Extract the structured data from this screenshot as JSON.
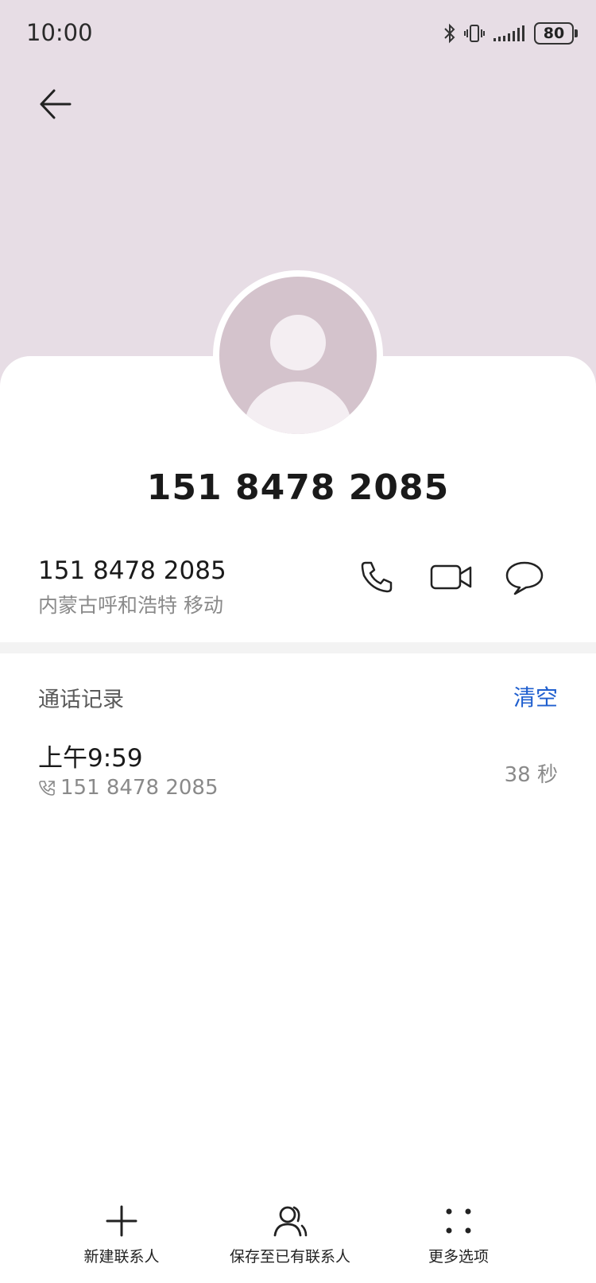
{
  "status_bar": {
    "time": "10:00",
    "battery": "80"
  },
  "contact": {
    "title": "151 8478 2085",
    "number": "151 8478 2085",
    "location": "内蒙古呼和浩特 移动"
  },
  "call_log": {
    "section_title": "通话记录",
    "clear_label": "清空",
    "entries": [
      {
        "time": "上午9:59",
        "number": "151 8478 2085",
        "duration": "38 秒"
      }
    ]
  },
  "bottom_bar": {
    "new_contact": "新建联系人",
    "save_existing": "保存至已有联系人",
    "more_options": "更多选项"
  },
  "colors": {
    "header_bg": "#e7dde5",
    "avatar_bg": "#d4c3cc",
    "accent": "#1f5fcf"
  }
}
